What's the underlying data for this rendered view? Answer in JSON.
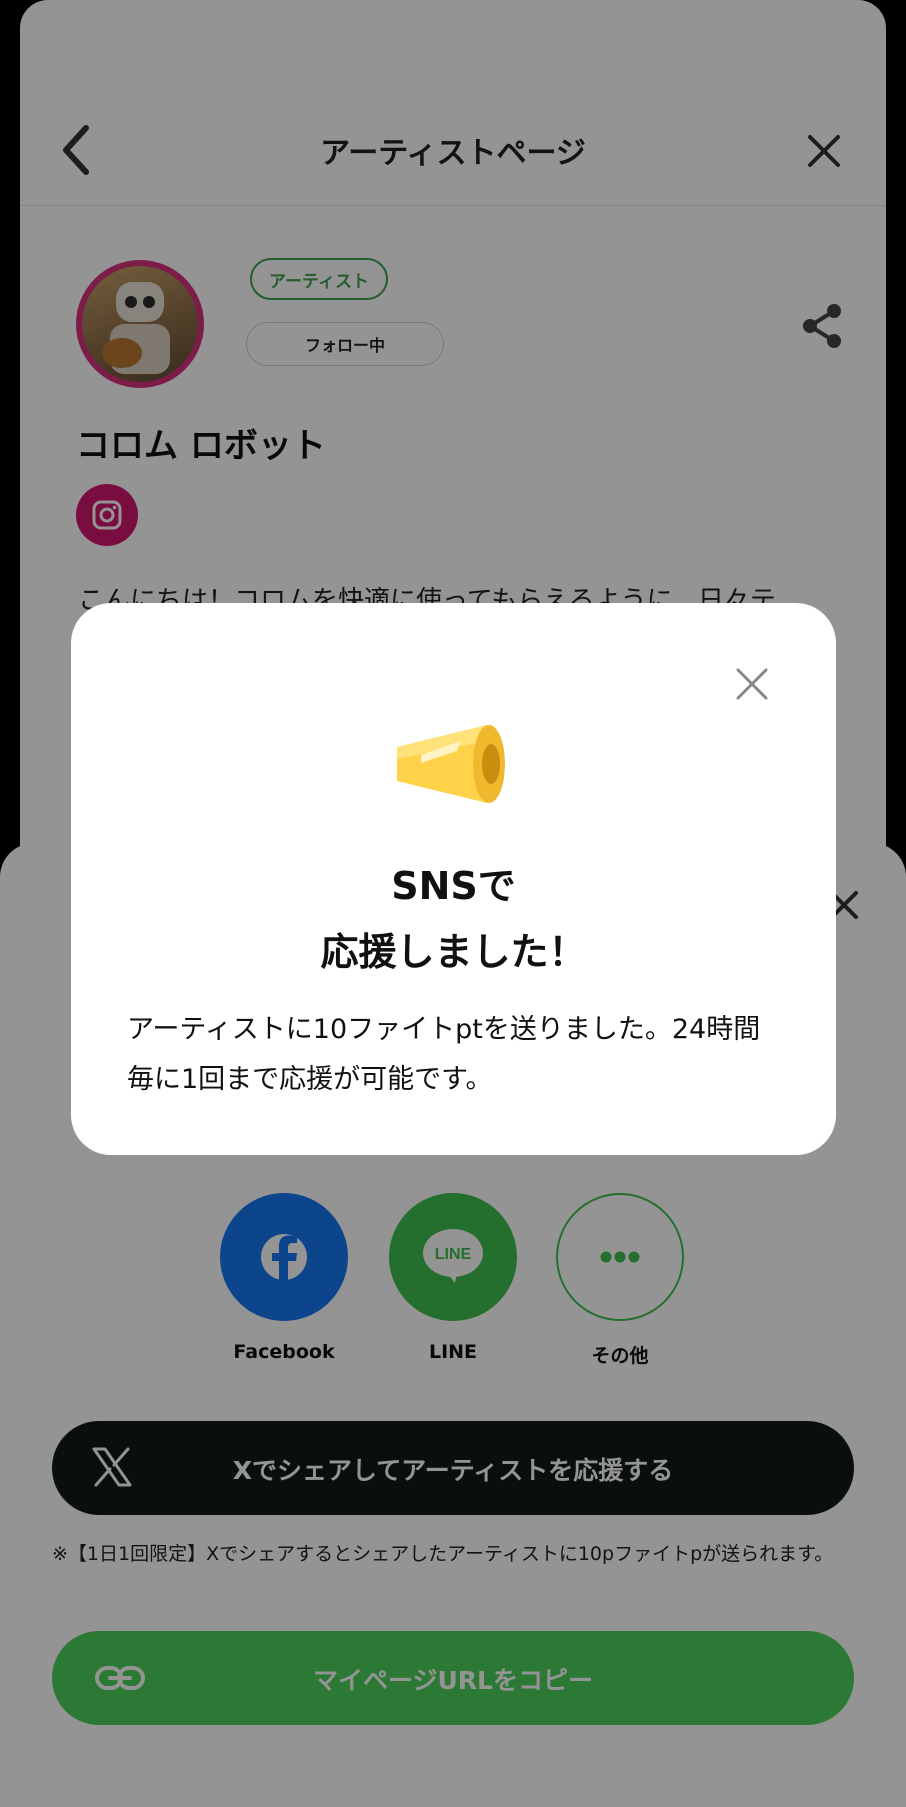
{
  "header": {
    "title": "アーティストページ"
  },
  "profile": {
    "badge": "アーティスト",
    "follow_label": "フォロー中",
    "name": "コロム ロボット",
    "intro": "こんにちは！コロムを快適に使ってもらえるように、日々テ"
  },
  "share_sheet": {
    "sns": [
      {
        "label": "Facebook",
        "icon": "facebook-icon"
      },
      {
        "label": "LINE",
        "icon": "line-icon"
      },
      {
        "label": "その他",
        "icon": "more-icon"
      }
    ],
    "x_share_label": "Xでシェアしてアーティストを応援する",
    "note": "※【1日1回限定】Xでシェアするとシェアしたアーティストに10pファイトpが送られます。",
    "copy_label": "マイページURLをコピー"
  },
  "modal": {
    "title_line1": "SNSで",
    "title_line2": "応援しました！",
    "message": "アーティストに10ファイトptを送りました。24時間毎に1回まで応援が可能です。"
  },
  "colors": {
    "accent_green": "#3fbf4f",
    "facebook_blue": "#1877f2",
    "x_black": "#101d14",
    "megaphone_yellow": "#ffd24a"
  }
}
